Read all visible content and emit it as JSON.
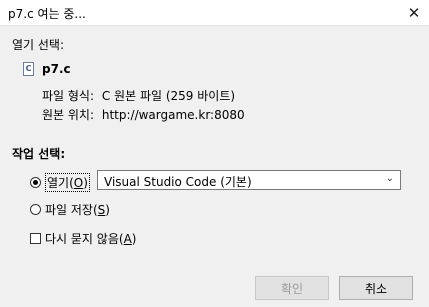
{
  "window": {
    "title": "p7.c 여는 중...",
    "close_icon": "close-icon"
  },
  "open_selection": {
    "section_label": "열기 선택:",
    "file_icon": "c-source-file-icon",
    "file_icon_glyph": "C",
    "file_name": "p7.c",
    "file_type_label": "파일 형식:",
    "file_type_value": "C 원본 파일 (259 바이트)",
    "source_label": "원본 위치:",
    "source_value": "http://wargame.kr:8080"
  },
  "action": {
    "section_label": "작업 선택:",
    "open_radio": {
      "label": "열기",
      "accel": "O",
      "checked": true
    },
    "app_select": {
      "value": "Visual Studio Code (기본)"
    },
    "save_radio": {
      "label": "파일 저장",
      "accel": "S",
      "checked": false
    },
    "dont_ask_checkbox": {
      "label": "다시 묻지 않음",
      "accel": "A",
      "checked": false
    }
  },
  "buttons": {
    "ok_label": "확인",
    "cancel_label": "취소"
  }
}
